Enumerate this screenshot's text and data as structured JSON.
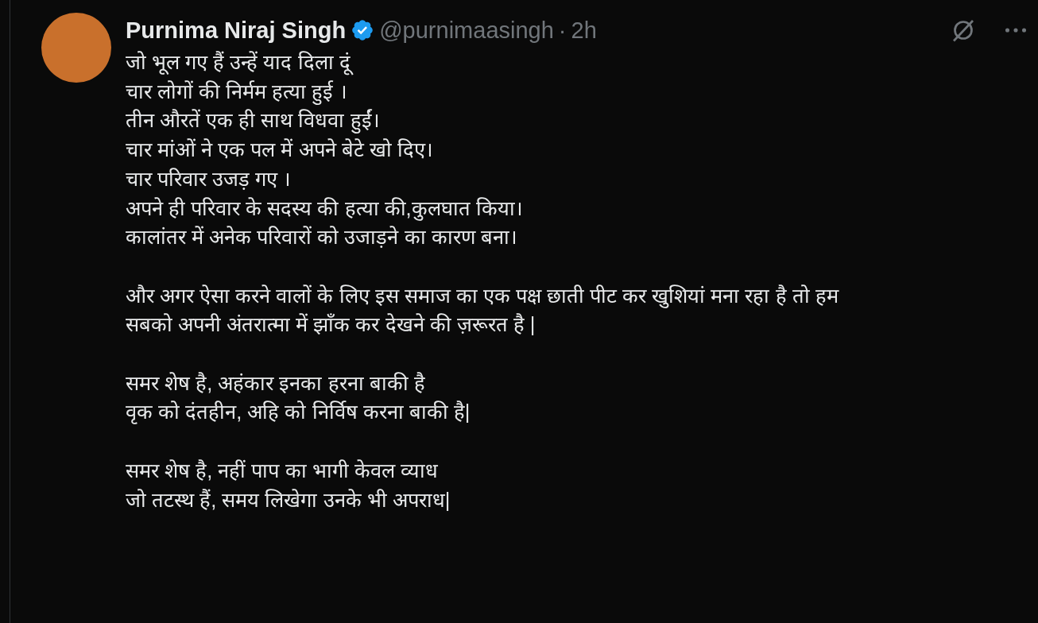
{
  "author": {
    "name": "Purnima Niraj Singh",
    "verified": true,
    "handle": "@purnimaasingh",
    "separator": "·",
    "time": "2h"
  },
  "paragraphs": [
    [
      "जो भूल गए हैं उन्हें याद दिला दूं",
      "चार लोगों की निर्मम हत्या हुई ।",
      "तीन औरतें एक ही साथ विधवा हुईं।",
      "चार मांओं ने एक पल में अपने बेटे खो दिए।",
      "चार परिवार उजड़ गए ।",
      "अपने ही परिवार के सदस्य की हत्या की,कुलघात किया।",
      "कालांतर में अनेक परिवारों को उजाड़ने का कारण बना।"
    ],
    [
      "और अगर ऐसा करने वालों के लिए इस समाज का एक पक्ष छाती पीट कर खुशियां मना रहा है तो हम",
      "सबको अपनी अंतरात्मा में झाँक कर देखने की ज़रूरत है |"
    ],
    [
      "समर शेष है, अहंकार इनका हरना बाकी है",
      "वृक को दंतहीन, अहि को निर्विष करना बाकी है|"
    ],
    [
      "समर शेष है, नहीं पाप का भागी केवल व्याध",
      "जो तटस्थ हैं, समय लिखेगा उनके भी अपराध|"
    ]
  ]
}
